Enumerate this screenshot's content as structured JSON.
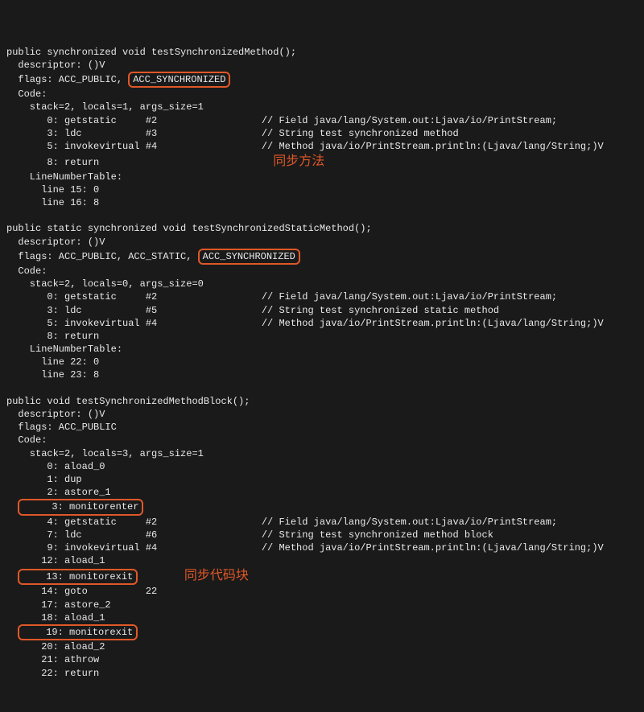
{
  "m1": {
    "sig": "public synchronized void testSynchronizedMethod();",
    "desc": "  descriptor: ()V",
    "flags_pre": "  flags: ACC_PUBLIC, ",
    "flag_box": "ACC_SYNCHRONIZED",
    "code": "  Code:",
    "stack": "    stack=2, locals=1, args_size=1",
    "l0": "       0: getstatic     #2                  // Field java/lang/System.out:Ljava/io/PrintStream;",
    "l3": "       3: ldc           #3                  // String test synchronized method",
    "l5": "       5: invokevirtual #4                  // Method java/io/PrintStream.println:(Ljava/lang/String;)V",
    "l8": "       8: return",
    "lnt": "    LineNumberTable:",
    "lnt1": "      line 15: 0",
    "lnt2": "      line 16: 8"
  },
  "label1": "同步方法",
  "m2": {
    "sig": "public static synchronized void testSynchronizedStaticMethod();",
    "desc": "  descriptor: ()V",
    "flags_pre": "  flags: ACC_PUBLIC, ACC_STATIC, ",
    "flag_box": "ACC_SYNCHRONIZED",
    "code": "  Code:",
    "stack": "    stack=2, locals=0, args_size=0",
    "l0": "       0: getstatic     #2                  // Field java/lang/System.out:Ljava/io/PrintStream;",
    "l3": "       3: ldc           #5                  // String test synchronized static method",
    "l5": "       5: invokevirtual #4                  // Method java/io/PrintStream.println:(Ljava/lang/String;)V",
    "l8": "       8: return",
    "lnt": "    LineNumberTable:",
    "lnt1": "      line 22: 0",
    "lnt2": "      line 23: 8"
  },
  "m3": {
    "sig": "public void testSynchronizedMethodBlock();",
    "desc": "  descriptor: ()V",
    "flags": "  flags: ACC_PUBLIC",
    "code": "  Code:",
    "stack": "    stack=2, locals=3, args_size=1",
    "l0": "       0: aload_0",
    "l1": "       1: dup",
    "l2": "       2: astore_1",
    "box3": "     3: monitorenter",
    "l4": "       4: getstatic     #2                  // Field java/lang/System.out:Ljava/io/PrintStream;",
    "l7": "       7: ldc           #6                  // String test synchronized method block",
    "l9": "       9: invokevirtual #4                  // Method java/io/PrintStream.println:(Ljava/lang/String;)V",
    "l12": "      12: aload_1",
    "box13": "    13: monitorexit",
    "l14": "      14: goto          22",
    "l17": "      17: astore_2",
    "l18": "      18: aload_1",
    "box19": "    19: monitorexit",
    "l20": "      20: aload_2",
    "l21": "      21: athrow",
    "l22": "      22: return"
  },
  "label2": "同步代码块"
}
